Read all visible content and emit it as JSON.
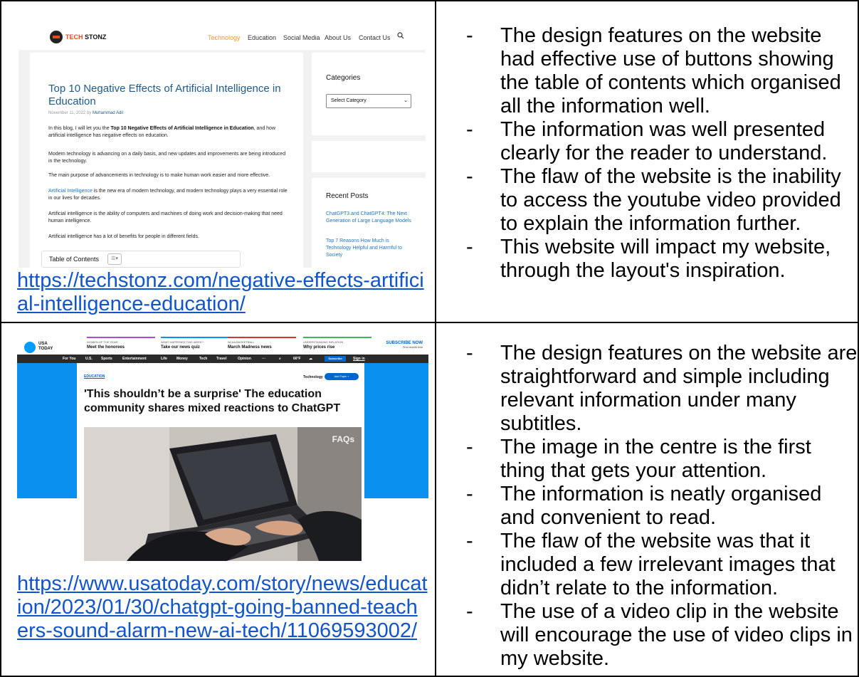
{
  "row1": {
    "screenshot": {
      "brand_a": "TECH ",
      "brand_b": "STONZ",
      "nav": [
        "Technology",
        "Education",
        "Social Media",
        "About Us",
        "Contact Us"
      ],
      "article_title": "Top 10 Negative Effects of Artificial Intelligence in Education",
      "meta_date": "November 11, 2022 by",
      "meta_author": "Muhammad Adil",
      "p1_a": "In this blog, I will let you the ",
      "p1_b": "Top 10 Negative Effects of Artificial Intelligence in Education",
      "p1_c": ", and how artificial intelligence has negative effects on education.",
      "p2": "Modern technology is advancing on a daily basis, and new updates and improvements are being introduced in the technology.",
      "p3": "The main purpose of advancements in technology is to make human work easier and more effective.",
      "p4_link": "Artificial Intelligence",
      "p4_rest": " is the new era of modern technology, and modern technology plays a very essential role in our lives for decades.",
      "p5": "Artificial intelligence is the ability of computers and machines of doing work and decision-making that need human intelligence.",
      "p6": "Artificial intelligence has a lot of benefits for people in different fields.",
      "toc": "Table of Contents",
      "categories_heading": "Categories",
      "select_category": "Select Category",
      "recent_posts_heading": "Recent Posts",
      "recent_post_1": "ChatGPT3 and ChatGPT4: The Next Generation of Large Language Models",
      "recent_post_2": "Top 7 Reasons How Much is Technology Helpful and Harmful to Society"
    },
    "url": "https://techstonz.com/negative-effects-artificial-intelligence-education/",
    "notes": [
      "The design features on the website had effective use of buttons showing the table of contents which organised all the information well.",
      "The information was well presented clearly for the reader to understand.",
      "The flaw of the website is the inability to access the youtube video provided to explain the information further.",
      "This website will impact my website, through the layout's inspiration."
    ]
  },
  "row2": {
    "screenshot": {
      "logo_line1": "USA",
      "logo_line2": "TODAY",
      "promos": [
        {
          "kicker": "WOMEN OF THE YEAR",
          "title": "Meet the honorees",
          "color": "#b04ad1"
        },
        {
          "kicker": "WHAT HAPPENED THIS WEEK?",
          "title": "Take our news quiz",
          "color": "#0a90ef"
        },
        {
          "kicker": "NCAA BASKETBALL",
          "title": "March Madness news",
          "color": "#d9342b"
        },
        {
          "kicker": "UNDERSTANDING INFLATION",
          "title": "Why prices rise",
          "color": "#3bb85a"
        }
      ],
      "subscribe": "SUBSCRIBE NOW",
      "subscribe_small": "First month free",
      "nav": [
        "For You",
        "U.S.",
        "Sports",
        "Entertainment",
        "Life",
        "Money",
        "Tech",
        "Travel",
        "Opinion"
      ],
      "weather": "66°F",
      "subscribe_btn": "Subscribe",
      "sign_in": "Sign in",
      "section": "EDUCATION",
      "topic": "Technology",
      "add_topic": "Add Topic +",
      "headline": "'This shouldn’t be a surprise' The education community shares mixed reactions to ChatGPT",
      "photo_label": "FAQs"
    },
    "url": "https://www.usatoday.com/story/news/education/2023/01/30/chatgpt-going-banned-teachers-sound-alarm-new-ai-tech/11069593002/",
    "notes": [
      "The design features on the website are straightforward and simple including relevant information under many subtitles.",
      "The image in the centre is the first thing that gets your attention.",
      "The information is neatly organised and convenient to read.",
      "The flaw of the website was that it included a few irrelevant images that didn’t relate to the information.",
      "The use of a video clip in the website will encourage the use of video clips in my website."
    ]
  },
  "bullet": "-"
}
